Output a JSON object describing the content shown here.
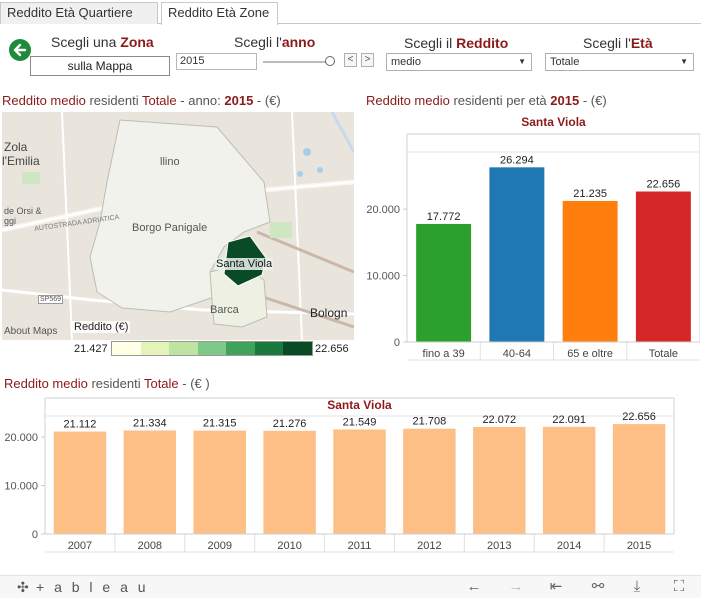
{
  "tabs": [
    {
      "label": "Reddito Età Quartiere",
      "active": false
    },
    {
      "label": "Reddito Età Zone",
      "active": true
    }
  ],
  "controls": {
    "zona": {
      "prefix": "Scegli una ",
      "highlight": "Zona",
      "button": "sulla Mappa"
    },
    "anno": {
      "prefix": "Scegli l'",
      "highlight": "anno",
      "value": "2015",
      "prev": "<",
      "next": ">"
    },
    "reddito": {
      "prefix": "Scegli il ",
      "highlight": "Reddito",
      "value": "medio"
    },
    "eta": {
      "prefix": "Scegli l'",
      "highlight": "Età",
      "value": "Totale"
    }
  },
  "map_section": {
    "title_a": "Reddito medio",
    "title_b": " residenti ",
    "title_c": "Totale",
    "title_d": " - anno: ",
    "title_e": "2015",
    "title_f": "  - (€)",
    "labels": {
      "borgo": "Borgo Panigale",
      "santa": "Santa Viola",
      "barca": "Barca",
      "bologna": "Bologn",
      "zola": "Zola",
      "emilia": "l'Emilia",
      "orsi": "de Orsi &",
      "ggi": "ggi",
      "autostrada": "AUTOSTRADA ADRIATICA",
      "sp569": "SP569",
      "lino": "llino",
      "about": "About Maps"
    },
    "legend": {
      "title": "Reddito (€)",
      "min": "21.427",
      "max": "22.656",
      "colors": [
        "#ffffe5",
        "#e4f4b9",
        "#bfe3a0",
        "#7ec98a",
        "#3fa35c",
        "#1a7a3d",
        "#0a4a24"
      ]
    }
  },
  "age_section": {
    "title_a": "Reddito medio",
    "title_b": " residenti per età  ",
    "title_c": "2015",
    "title_d": "  - (€)"
  },
  "year_section": {
    "title_a": "Reddito medio",
    "title_b": " residenti ",
    "title_c": "Totale",
    "title_d": " - (€ )"
  },
  "chart_data": [
    {
      "type": "bar",
      "title": "Santa Viola",
      "categories": [
        "fino a 39",
        "40-64",
        "65 e oltre",
        "Totale"
      ],
      "values": [
        17772,
        26294,
        21235,
        22656
      ],
      "labels": [
        "17.772",
        "26.294",
        "21.235",
        "22.656"
      ],
      "colors": [
        "#2ca02c",
        "#1f77b4",
        "#ff7f0e",
        "#d62728"
      ],
      "ylim": [
        0,
        28000
      ],
      "yticks": [
        0,
        10000,
        20000
      ],
      "ytick_labels": [
        "0",
        "10.000",
        "20.000"
      ]
    },
    {
      "type": "bar",
      "title": "Santa Viola",
      "categories": [
        "2007",
        "2008",
        "2009",
        "2010",
        "2011",
        "2012",
        "2013",
        "2014",
        "2015"
      ],
      "values": [
        21112,
        21334,
        21315,
        21276,
        21549,
        21708,
        22072,
        22091,
        22656
      ],
      "labels": [
        "21.112",
        "21.334",
        "21.315",
        "21.276",
        "21.549",
        "21.708",
        "22.072",
        "22.091",
        "22.656"
      ],
      "color": "#fdbf86",
      "ylim": [
        0,
        23500
      ],
      "yticks": [
        0,
        10000,
        20000
      ],
      "ytick_labels": [
        "0",
        "10.000",
        "20.000"
      ]
    }
  ],
  "footer": {
    "brand": "+ a b l e a u",
    "icons": [
      "undo-icon",
      "redo-icon",
      "revert-icon",
      "share-icon",
      "download-icon",
      "fullscreen-icon"
    ]
  }
}
